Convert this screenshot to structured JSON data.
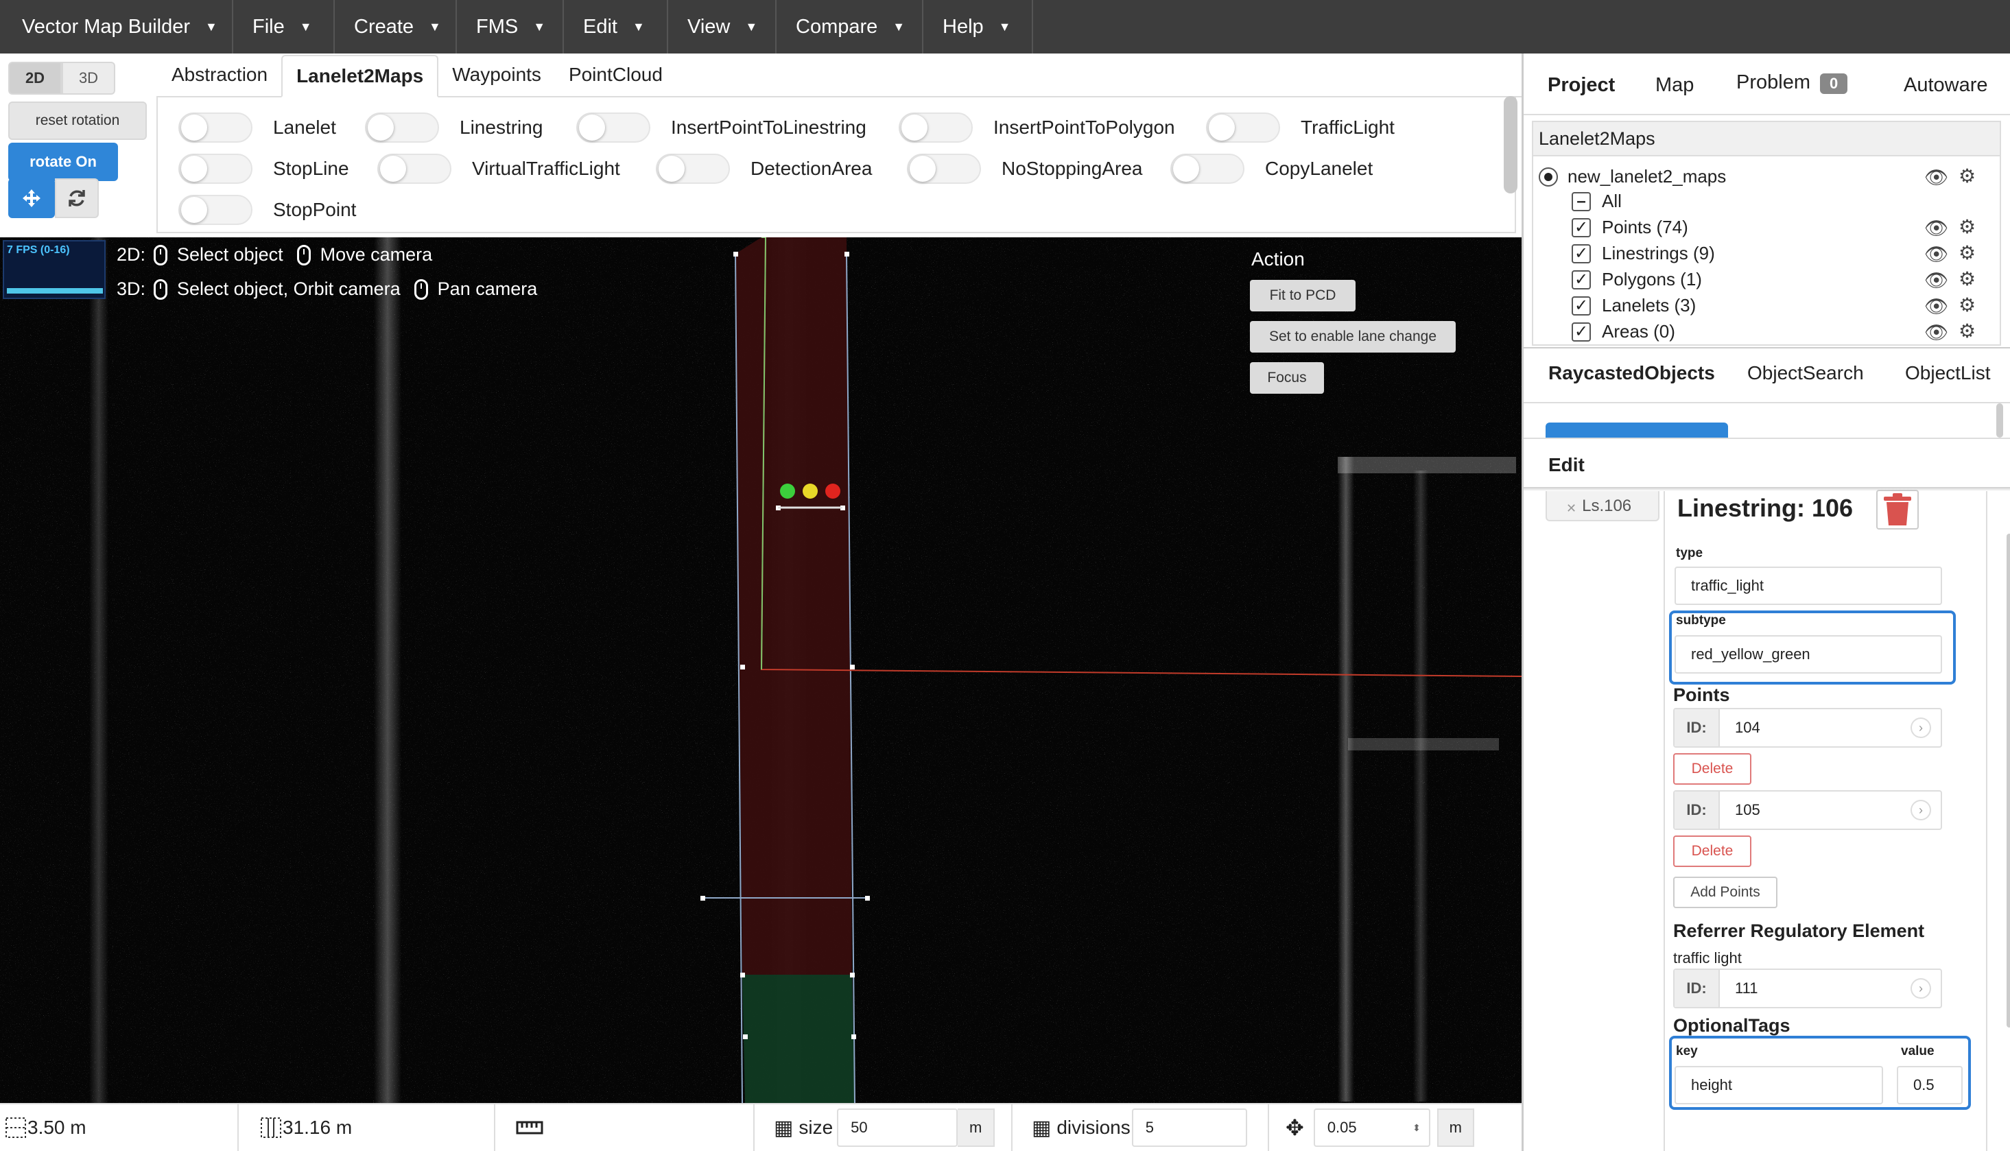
{
  "menubar": {
    "app_title": "Vector Map Builder",
    "items": [
      "File",
      "Create",
      "FMS",
      "Edit",
      "View",
      "Compare",
      "Help"
    ]
  },
  "view_controls": {
    "mode_2d": "2D",
    "mode_3d": "3D",
    "active_mode": "2D",
    "reset_rotation": "reset rotation",
    "rotate": "rotate On",
    "move_icon": "move-arrows-icon",
    "rotate_icon": "refresh-icon"
  },
  "tabs": {
    "items": [
      "Abstraction",
      "Lanelet2Maps",
      "Waypoints",
      "PointCloud"
    ],
    "active": "Lanelet2Maps"
  },
  "toggles": [
    "Lanelet",
    "Linestring",
    "InsertPointToLinestring",
    "InsertPointToPolygon",
    "TrafficLight",
    "StopLine",
    "VirtualTrafficLight",
    "DetectionArea",
    "NoStoppingArea",
    "CopyLanelet",
    "StopPoint"
  ],
  "viewport": {
    "fps": "7 FPS (0-16)",
    "hint_2d_prefix": "2D:",
    "hint_2d_left": "Select object",
    "hint_2d_right": "Move camera",
    "hint_3d_prefix": "3D:",
    "hint_3d_left": "Select object, Orbit camera",
    "hint_3d_right": "Pan camera",
    "action_title": "Action",
    "actions": [
      "Fit to PCD",
      "Set to enable lane change",
      "Focus"
    ],
    "traffic_light_colors": [
      "#3ccf3c",
      "#e8d728",
      "#e0241e"
    ]
  },
  "statusbar": {
    "scale_a": "3.50 m",
    "scale_b": "31.16 m",
    "size_label": "size",
    "size_value": "50",
    "size_unit": "m",
    "divisions_label": "divisions",
    "divisions_value": "5",
    "step_value": "0.05",
    "step_unit": "m"
  },
  "right_panel": {
    "top_tabs": [
      "Project",
      "Map",
      "Problem",
      "Autoware"
    ],
    "active_top_tab": "Project",
    "problem_count": "0",
    "tree_header": "Lanelet2Maps",
    "tree_root": "new_lanelet2_maps",
    "tree_all": "All",
    "tree_items": [
      "Points (74)",
      "Linestrings (9)",
      "Polygons (1)",
      "Lanelets (3)",
      "Areas (0)"
    ],
    "object_tabs": [
      "RaycastedObjects",
      "ObjectSearch",
      "ObjectList"
    ],
    "active_object_tab": "RaycastedObjects",
    "edit_title": "Edit",
    "side_tag": "Ls.106",
    "object_title": "Linestring: 106",
    "type_label": "type",
    "type_value": "traffic_light",
    "subtype_label": "subtype",
    "subtype_value": "red_yellow_green",
    "points_title": "Points",
    "id_prefix": "ID:",
    "points": [
      "104",
      "105"
    ],
    "delete_label": "Delete",
    "add_points_label": "Add Points",
    "referrer_title": "Referrer Regulatory Element",
    "referrer_type": "traffic light",
    "referrer_id": "111",
    "optional_title": "OptionalTags",
    "key_label": "key",
    "value_label": "value",
    "key_value": "height",
    "value_value": "0.5"
  }
}
